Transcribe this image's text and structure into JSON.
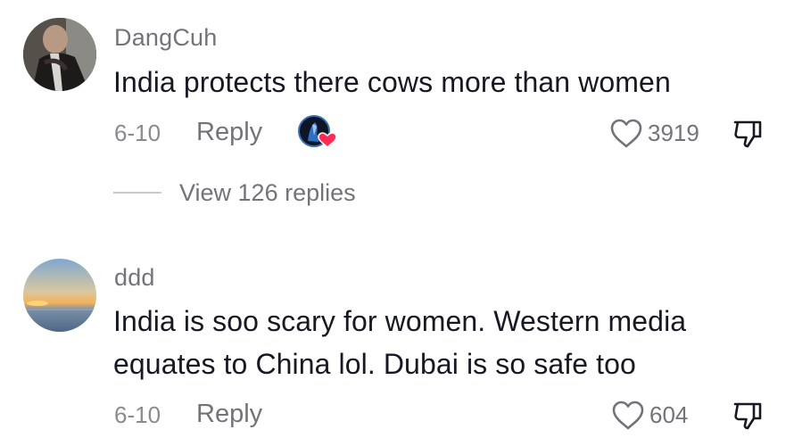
{
  "comments": [
    {
      "username": "DangCuh",
      "text": "India protects there cows more than women",
      "date": "6-10",
      "reply_label": "Reply",
      "likes": "3919",
      "creator_liked": true,
      "view_replies_label": "View 126 replies"
    },
    {
      "username": "ddd",
      "text": "India is soo scary for women. Western media equates to China lol. Dubai is so safe too",
      "date": "6-10",
      "reply_label": "Reply",
      "likes": "604",
      "creator_liked": false
    }
  ],
  "icons": {
    "like": "heart-outline-icon",
    "dislike": "thumbs-down-icon",
    "creator_like": "creator-heart-badge"
  },
  "colors": {
    "primary_text": "#161823",
    "secondary_text": "#73747b",
    "creator_heart": "#fe2c55"
  }
}
